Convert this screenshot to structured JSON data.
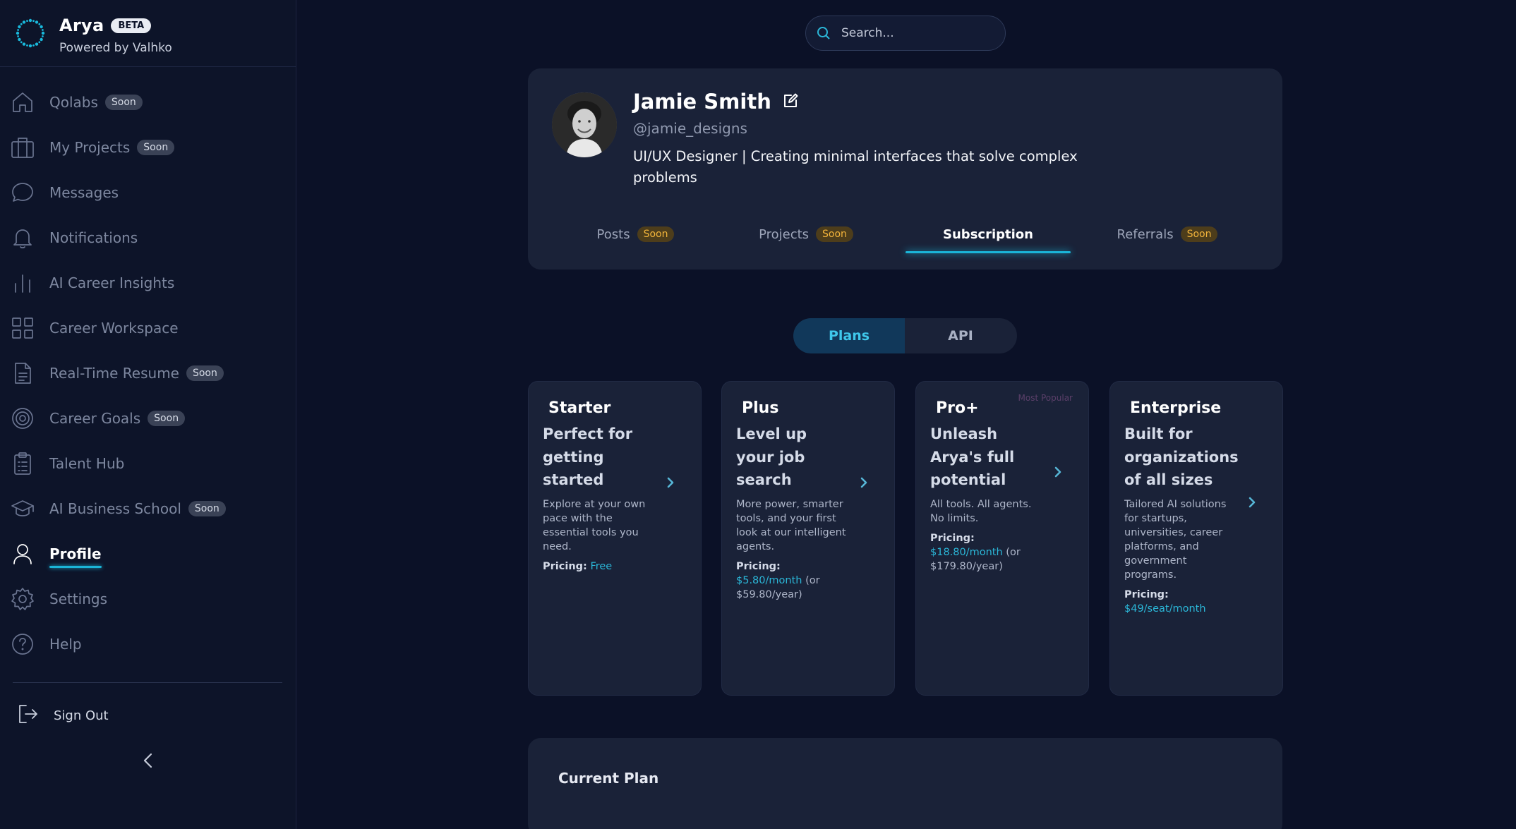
{
  "brand": {
    "name": "Arya",
    "beta_label": "BETA",
    "subtitle": "Powered by Valhko",
    "accent_color": "#1bb5d8"
  },
  "sidebar": {
    "items": [
      {
        "label": "Qolabs",
        "icon": "home-icon",
        "badge": "Soon",
        "active": false
      },
      {
        "label": "My Projects",
        "icon": "briefcase-icon",
        "badge": "Soon",
        "active": false
      },
      {
        "label": "Messages",
        "icon": "chat-bubble-icon",
        "badge": null,
        "active": false
      },
      {
        "label": "Notifications",
        "icon": "bell-icon",
        "badge": null,
        "active": false
      },
      {
        "label": "AI Career Insights",
        "icon": "bar-chart-icon",
        "badge": null,
        "active": false
      },
      {
        "label": "Career Workspace",
        "icon": "grid-icon",
        "badge": null,
        "active": false
      },
      {
        "label": "Real-Time Resume",
        "icon": "document-icon",
        "badge": "Soon",
        "active": false
      },
      {
        "label": "Career Goals",
        "icon": "target-icon",
        "badge": "Soon",
        "active": false
      },
      {
        "label": "Talent Hub",
        "icon": "clipboard-icon",
        "badge": null,
        "active": false
      },
      {
        "label": "AI Business School",
        "icon": "graduation-cap-icon",
        "badge": "Soon",
        "active": false
      },
      {
        "label": "Profile",
        "icon": "user-icon",
        "badge": null,
        "active": true
      },
      {
        "label": "Settings",
        "icon": "gear-icon",
        "badge": null,
        "active": false
      },
      {
        "label": "Help",
        "icon": "help-circle-icon",
        "badge": null,
        "active": false
      }
    ],
    "sign_out_label": "Sign Out"
  },
  "search": {
    "placeholder": "Search..."
  },
  "profile": {
    "name": "Jamie Smith",
    "handle": "@jamie_designs",
    "bio": "UI/UX Designer | Creating minimal interfaces that solve complex problems",
    "tabs": [
      {
        "label": "Posts",
        "badge": "Soon",
        "active": false
      },
      {
        "label": "Projects",
        "badge": "Soon",
        "active": false
      },
      {
        "label": "Subscription",
        "badge": null,
        "active": true
      },
      {
        "label": "Referrals",
        "badge": "Soon",
        "active": false
      }
    ]
  },
  "plans_toggle": {
    "options": [
      "Plans",
      "API"
    ],
    "selected": "Plans"
  },
  "plans": [
    {
      "name": "Starter",
      "badge": "",
      "headline": "Perfect for getting started",
      "description": "Explore at your own pace with the essential tools you need.",
      "pricing_label": "Pricing:",
      "price_accent": "Free",
      "price_extra": ""
    },
    {
      "name": "Plus",
      "badge": "",
      "headline": "Level up your job search",
      "description": "More power, smarter tools, and your first look at our intelligent agents.",
      "pricing_label": "Pricing:",
      "price_accent": "$5.80/month",
      "price_extra": "(or $59.80/year)"
    },
    {
      "name": "Pro+",
      "badge": "Most Popular",
      "headline": "Unleash Arya's full potential",
      "description": "All tools. All agents. No limits.",
      "pricing_label": "Pricing:",
      "price_accent": "$18.80/month",
      "price_extra": "(or $179.80/year)"
    },
    {
      "name": "Enterprise",
      "badge": "",
      "headline": "Built for organizations of all sizes",
      "description": "Tailored AI solutions for startups, universities, career platforms, and government programs.",
      "pricing_label": "Pricing:",
      "price_accent": "$49/seat/month",
      "price_extra": ""
    }
  ],
  "current_plan": {
    "title": "Current Plan"
  }
}
